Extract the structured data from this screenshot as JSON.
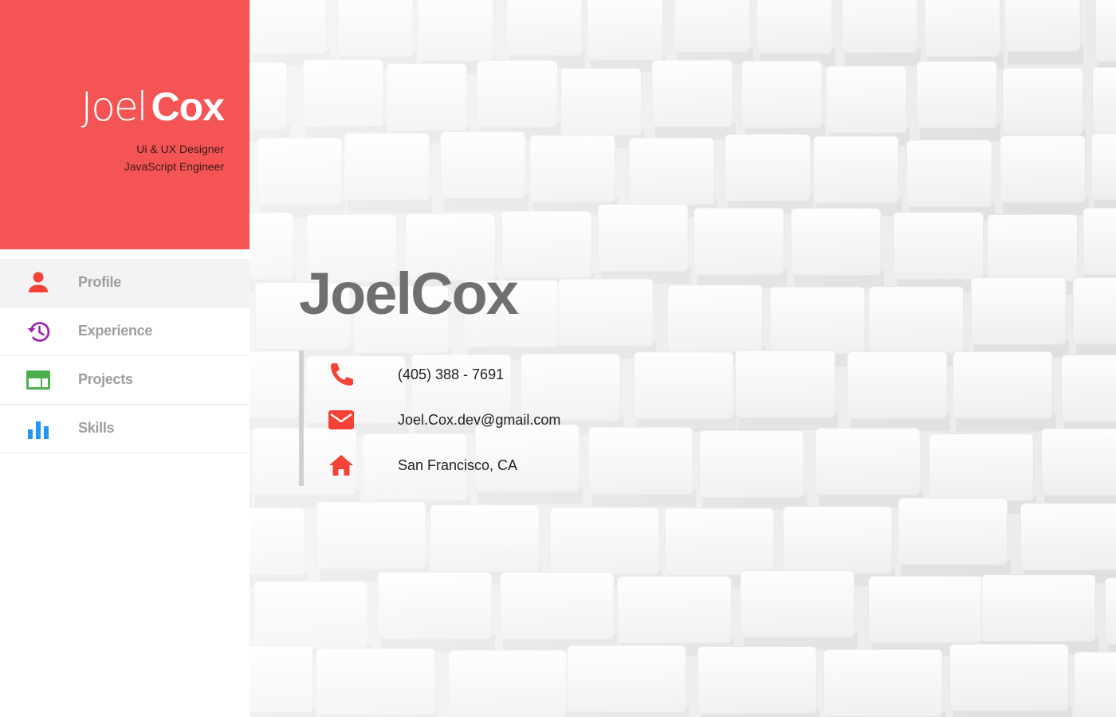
{
  "profile": {
    "first_name": "Joel",
    "last_name": "Cox",
    "roles": [
      "Ui & UX Designer",
      "JavaScript Engineer"
    ],
    "hero_name": "JoelCox"
  },
  "nav": {
    "items": [
      {
        "label": "Profile",
        "icon": "person-icon",
        "color": "#f44336",
        "active": true
      },
      {
        "label": "Experience",
        "icon": "history-icon",
        "color": "#9c27b0",
        "active": false
      },
      {
        "label": "Projects",
        "icon": "web-layout-icon",
        "color": "#4caf50",
        "active": false
      },
      {
        "label": "Skills",
        "icon": "bar-chart-icon",
        "color": "#2196f3",
        "active": false
      }
    ]
  },
  "contact": {
    "phone": "(405) 388 - 7691",
    "email": "Joel.Cox.dev@gmail.com",
    "location": "San Francisco, CA",
    "icon_color": "#f44336"
  },
  "colors": {
    "accent": "#f55454",
    "nav_text": "#9e9e9e"
  }
}
